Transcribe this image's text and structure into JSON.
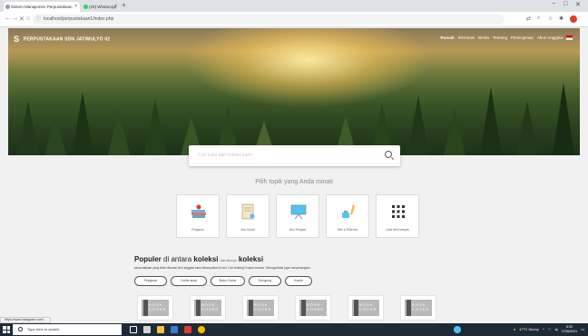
{
  "browser": {
    "tabs": [
      {
        "label": "Sistem Manajemen Perpustakaan",
        "active": true
      },
      {
        "label": "(20) WhatsApp",
        "active": false
      }
    ],
    "url": "localhost/perpustakaan1/index.php",
    "window_controls": [
      "−",
      "□",
      "✕"
    ]
  },
  "hero": {
    "brand_logo": "S",
    "brand_name": "PERPUSTAKAAN SDN JATIMULYO 02",
    "nav": [
      {
        "label": "Rumah",
        "active": true
      },
      {
        "label": "Informasi",
        "active": false
      },
      {
        "label": "Berita",
        "active": false
      },
      {
        "label": "Tentang",
        "active": false
      },
      {
        "label": "Peminjaman",
        "active": false
      },
      {
        "label": "Akun Anggota",
        "active": false
      }
    ]
  },
  "search": {
    "placeholder": "Cari buku dari koleksi kami"
  },
  "topics": {
    "title": "Pilih topik yang Anda minati",
    "items": [
      {
        "label": "Pelajaran"
      },
      {
        "label": "Ilmu Sosial"
      },
      {
        "label": "Ilmu Terapan"
      },
      {
        "label": "Seni & Rekreasi"
      },
      {
        "label": "Lihat lebih banyak"
      }
    ]
  },
  "popular": {
    "title_strong": "Populer",
    "title_mid": "di antara",
    "title_strong2": "koleksi",
    "title_small": "dan lainnya",
    "title_end": "koleksi",
    "subtitle": "perpustakaan yang telah dikurasi oleh anggota kami dikumpulkan di sini. Cari tentang Proyek mereka. Semoga tidak juga menyenangkan.",
    "chips": [
      "Pelajaran",
      "Cerita anak",
      "Buku Cerita",
      "Dongeng",
      "Komik"
    ],
    "book_cover_text": "BOOK COVER"
  },
  "status_url": "https://www.instagram.com/...",
  "taskbar": {
    "search_placeholder": "Type here to search",
    "weather": "17°C Sunny",
    "time": "8:03",
    "date": "27/06/2021"
  },
  "colors": {
    "taskbar": "#1f2a38",
    "accent_red": "#e53935"
  }
}
